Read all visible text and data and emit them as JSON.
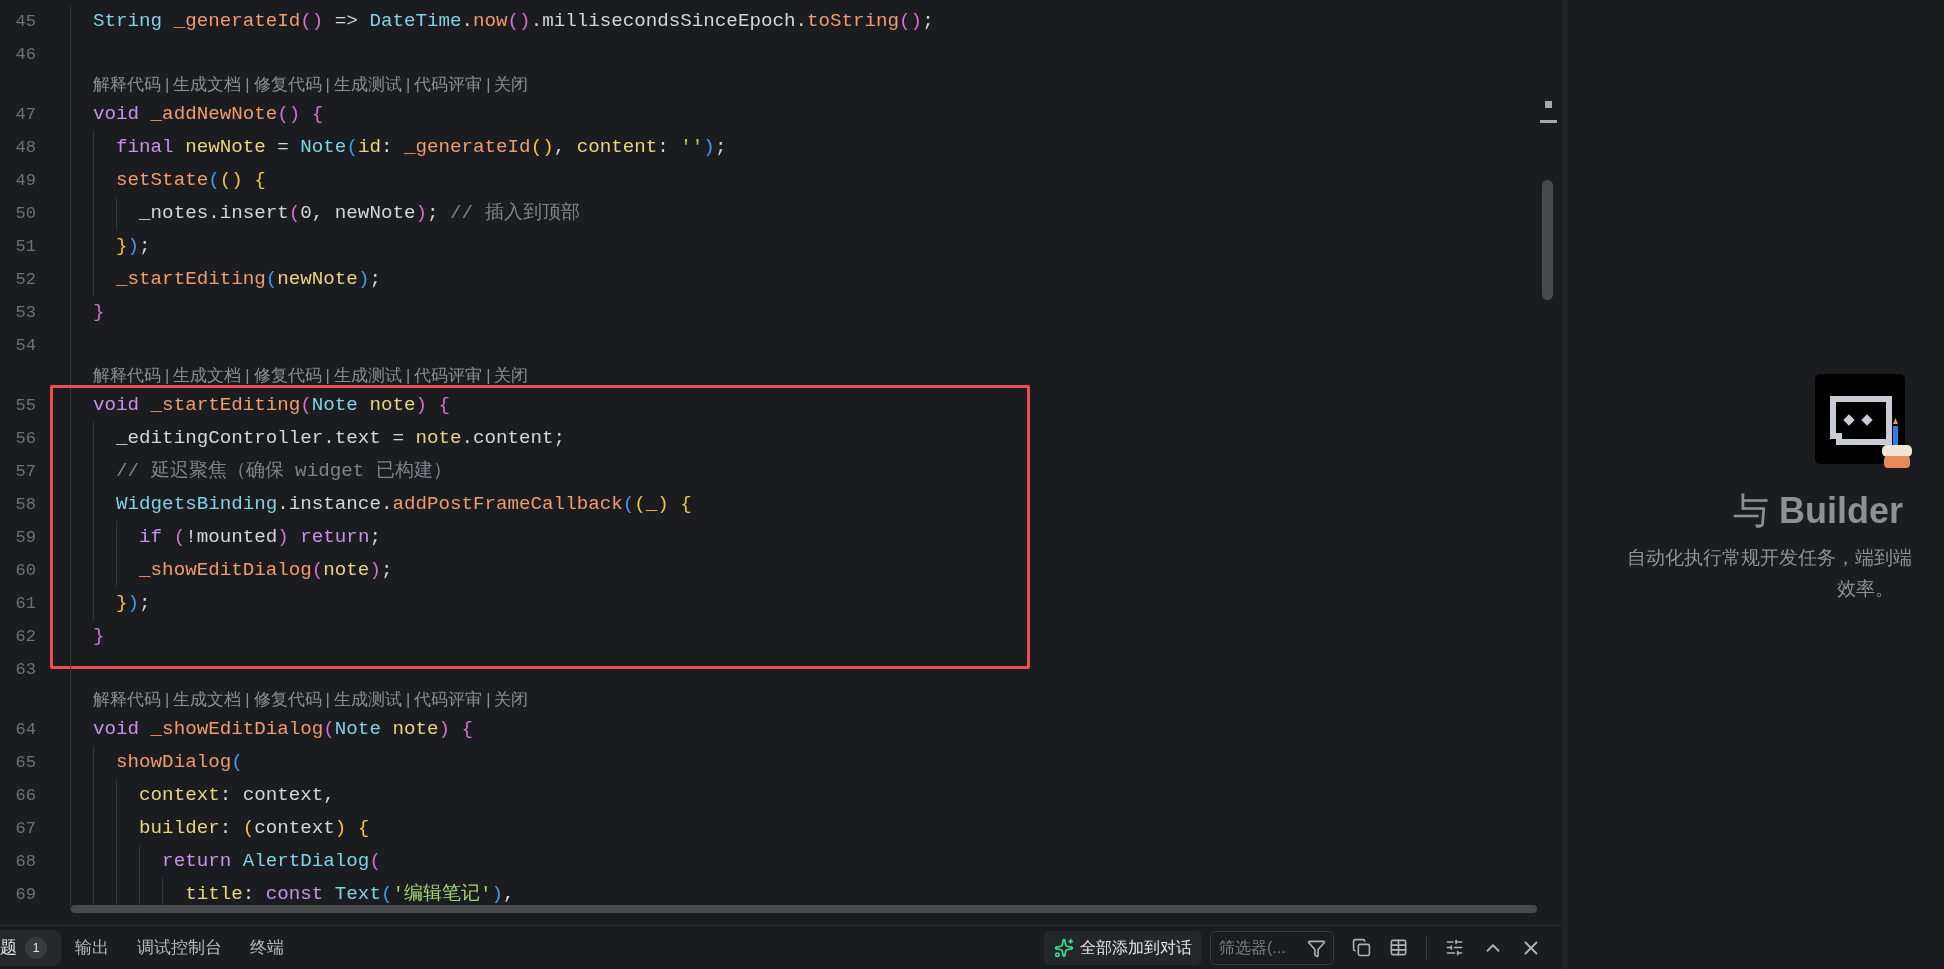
{
  "editor": {
    "rows": [
      {
        "kind": "line",
        "number": "45",
        "tokens": [
          {
            "text": "  String",
            "kind": "type"
          },
          {
            "text": " _generateId",
            "kind": "fn"
          },
          {
            "text": "()",
            "kind": "b2"
          },
          {
            "text": " => ",
            "kind": "p"
          },
          {
            "text": "DateTime",
            "kind": "type"
          },
          {
            "text": ".",
            "kind": "p"
          },
          {
            "text": "now",
            "kind": "fn"
          },
          {
            "text": "()",
            "kind": "b2"
          },
          {
            "text": ".millisecondsSinceEpoch.",
            "kind": "p"
          },
          {
            "text": "toString",
            "kind": "fn"
          },
          {
            "text": "()",
            "kind": "b2"
          },
          {
            "text": ";",
            "kind": "p"
          }
        ]
      },
      {
        "kind": "line",
        "number": "46"
      },
      {
        "kind": "lens",
        "separator": "|",
        "actions": [
          "解释代码",
          "生成文档",
          "修复代码",
          "生成测试",
          "代码评审",
          "关闭"
        ]
      },
      {
        "kind": "line",
        "number": "47",
        "tokens": [
          {
            "text": "  void",
            "kind": "kw"
          },
          {
            "text": " _addNewNote",
            "kind": "fn"
          },
          {
            "text": "()",
            "kind": "b2"
          },
          {
            "text": " {",
            "kind": "b2"
          }
        ]
      },
      {
        "kind": "line",
        "number": "48",
        "tokens": [
          {
            "text": "    final",
            "kind": "kw"
          },
          {
            "text": " newNote",
            "kind": "param"
          },
          {
            "text": " = ",
            "kind": "p"
          },
          {
            "text": "Note",
            "kind": "type"
          },
          {
            "text": "(",
            "kind": "b3"
          },
          {
            "text": "id",
            "kind": "param"
          },
          {
            "text": ": ",
            "kind": "p"
          },
          {
            "text": "_generateId",
            "kind": "fn"
          },
          {
            "text": "()",
            "kind": "b1"
          },
          {
            "text": ", ",
            "kind": "p"
          },
          {
            "text": "content",
            "kind": "param"
          },
          {
            "text": ": ",
            "kind": "p"
          },
          {
            "text": "''",
            "kind": "str"
          },
          {
            "text": ")",
            "kind": "b3"
          },
          {
            "text": ";",
            "kind": "p"
          }
        ]
      },
      {
        "kind": "line",
        "number": "49",
        "tokens": [
          {
            "text": "    setState",
            "kind": "fn"
          },
          {
            "text": "(",
            "kind": "b3"
          },
          {
            "text": "()",
            "kind": "b1"
          },
          {
            "text": " {",
            "kind": "b1"
          }
        ]
      },
      {
        "kind": "line",
        "number": "50",
        "tokens": [
          {
            "text": "      _notes.insert",
            "kind": "p"
          },
          {
            "text": "(",
            "kind": "b2"
          },
          {
            "text": "0, newNote",
            "kind": "p"
          },
          {
            "text": ")",
            "kind": "b2"
          },
          {
            "text": ";",
            "kind": "p"
          },
          {
            "text": " // 插入到顶部",
            "kind": "cmt"
          }
        ]
      },
      {
        "kind": "line",
        "number": "51",
        "tokens": [
          {
            "text": "    }",
            "kind": "b1"
          },
          {
            "text": ")",
            "kind": "b3"
          },
          {
            "text": ";",
            "kind": "p"
          }
        ]
      },
      {
        "kind": "line",
        "number": "52",
        "tokens": [
          {
            "text": "    _startEditing",
            "kind": "fn"
          },
          {
            "text": "(",
            "kind": "b3"
          },
          {
            "text": "newNote",
            "kind": "param"
          },
          {
            "text": ")",
            "kind": "b3"
          },
          {
            "text": ";",
            "kind": "p"
          }
        ]
      },
      {
        "kind": "line",
        "number": "53",
        "tokens": [
          {
            "text": "  }",
            "kind": "b2"
          }
        ]
      },
      {
        "kind": "line",
        "number": "54"
      },
      {
        "kind": "lens",
        "separator": "|",
        "actions": [
          "解释代码",
          "生成文档",
          "修复代码",
          "生成测试",
          "代码评审",
          "关闭"
        ]
      },
      {
        "kind": "highlight",
        "rows": [
          {
            "kind": "line",
            "number": "55",
            "tokens": [
              {
                "text": "  void",
                "kind": "kw"
              },
              {
                "text": " _startEditing",
                "kind": "fn"
              },
              {
                "text": "(",
                "kind": "b2"
              },
              {
                "text": "Note",
                "kind": "type"
              },
              {
                "text": " note",
                "kind": "param"
              },
              {
                "text": ")",
                "kind": "b2"
              },
              {
                "text": " {",
                "kind": "b2"
              }
            ]
          },
          {
            "kind": "line",
            "number": "56",
            "tokens": [
              {
                "text": "    _editingController.text = ",
                "kind": "p"
              },
              {
                "text": "note",
                "kind": "param"
              },
              {
                "text": ".content;",
                "kind": "p"
              }
            ]
          },
          {
            "kind": "line",
            "number": "57",
            "tokens": [
              {
                "text": "    // 延迟聚焦（确保 widget 已构建）",
                "kind": "cmt"
              }
            ]
          },
          {
            "kind": "line",
            "number": "58",
            "tokens": [
              {
                "text": "    WidgetsBinding",
                "kind": "type"
              },
              {
                "text": ".instance.",
                "kind": "p"
              },
              {
                "text": "addPostFrameCallback",
                "kind": "fn"
              },
              {
                "text": "(",
                "kind": "b3"
              },
              {
                "text": "(_)",
                "kind": "b1"
              },
              {
                "text": " {",
                "kind": "b1"
              }
            ]
          },
          {
            "kind": "line",
            "number": "59",
            "tokens": [
              {
                "text": "      if",
                "kind": "kw"
              },
              {
                "text": " (",
                "kind": "b2"
              },
              {
                "text": "!mounted",
                "kind": "p"
              },
              {
                "text": ")",
                "kind": "b2"
              },
              {
                "text": " return",
                "kind": "kw"
              },
              {
                "text": ";",
                "kind": "p"
              }
            ]
          },
          {
            "kind": "line",
            "number": "60",
            "tokens": [
              {
                "text": "      _showEditDialog",
                "kind": "fn"
              },
              {
                "text": "(",
                "kind": "b2"
              },
              {
                "text": "note",
                "kind": "param"
              },
              {
                "text": ")",
                "kind": "b2"
              },
              {
                "text": ";",
                "kind": "p"
              }
            ]
          },
          {
            "kind": "line",
            "number": "61",
            "tokens": [
              {
                "text": "    }",
                "kind": "b1"
              },
              {
                "text": ")",
                "kind": "b3"
              },
              {
                "text": ";",
                "kind": "p"
              }
            ]
          },
          {
            "kind": "line",
            "number": "62",
            "tokens": [
              {
                "text": "  }",
                "kind": "b2"
              }
            ]
          }
        ]
      },
      {
        "kind": "line",
        "number": "63"
      },
      {
        "kind": "lens",
        "separator": "|",
        "actions": [
          "解释代码",
          "生成文档",
          "修复代码",
          "生成测试",
          "代码评审",
          "关闭"
        ]
      },
      {
        "kind": "line",
        "number": "64",
        "tokens": [
          {
            "text": "  void",
            "kind": "kw"
          },
          {
            "text": " _showEditDialog",
            "kind": "fn"
          },
          {
            "text": "(",
            "kind": "b2"
          },
          {
            "text": "Note",
            "kind": "type"
          },
          {
            "text": " note",
            "kind": "param"
          },
          {
            "text": ")",
            "kind": "b2"
          },
          {
            "text": " {",
            "kind": "b2"
          }
        ]
      },
      {
        "kind": "line",
        "number": "65",
        "tokens": [
          {
            "text": "    showDialog",
            "kind": "fn"
          },
          {
            "text": "(",
            "kind": "b3"
          }
        ]
      },
      {
        "kind": "line",
        "number": "66",
        "tokens": [
          {
            "text": "      context",
            "kind": "param"
          },
          {
            "text": ": context,",
            "kind": "p"
          }
        ]
      },
      {
        "kind": "line",
        "number": "67",
        "tokens": [
          {
            "text": "      builder",
            "kind": "param"
          },
          {
            "text": ": ",
            "kind": "p"
          },
          {
            "text": "(",
            "kind": "b1"
          },
          {
            "text": "context",
            "kind": "p"
          },
          {
            "text": ")",
            "kind": "b1"
          },
          {
            "text": " {",
            "kind": "b1"
          }
        ]
      },
      {
        "kind": "line",
        "number": "68",
        "tokens": [
          {
            "text": "        return",
            "kind": "kw"
          },
          {
            "text": " AlertDialog",
            "kind": "type"
          },
          {
            "text": "(",
            "kind": "b2"
          }
        ]
      },
      {
        "kind": "line",
        "number": "69",
        "tokens": [
          {
            "text": "          title",
            "kind": "param"
          },
          {
            "text": ": ",
            "kind": "p"
          },
          {
            "text": "const",
            "kind": "kw"
          },
          {
            "text": " Text",
            "kind": "type"
          },
          {
            "text": "(",
            "kind": "b3"
          },
          {
            "text": "'编辑笔记'",
            "kind": "str"
          },
          {
            "text": ")",
            "kind": "b3"
          },
          {
            "text": ",",
            "kind": "p"
          }
        ]
      }
    ]
  },
  "assistant_panel": {
    "title": "与 **Builder**",
    "description_lines": [
      "自动化执行常规开发任务，端到端",
      "效率。"
    ]
  },
  "bottom_panel": {
    "tabs": [
      {
        "label": "题",
        "selected": true,
        "badge": "1"
      },
      {
        "label": "输出",
        "selected": false
      },
      {
        "label": "调试控制台",
        "selected": false
      },
      {
        "label": "终端",
        "selected": false
      }
    ],
    "add_all_button": {
      "label": "全部添加到对话"
    },
    "filter": {
      "placeholder": "筛选器(..."
    }
  }
}
